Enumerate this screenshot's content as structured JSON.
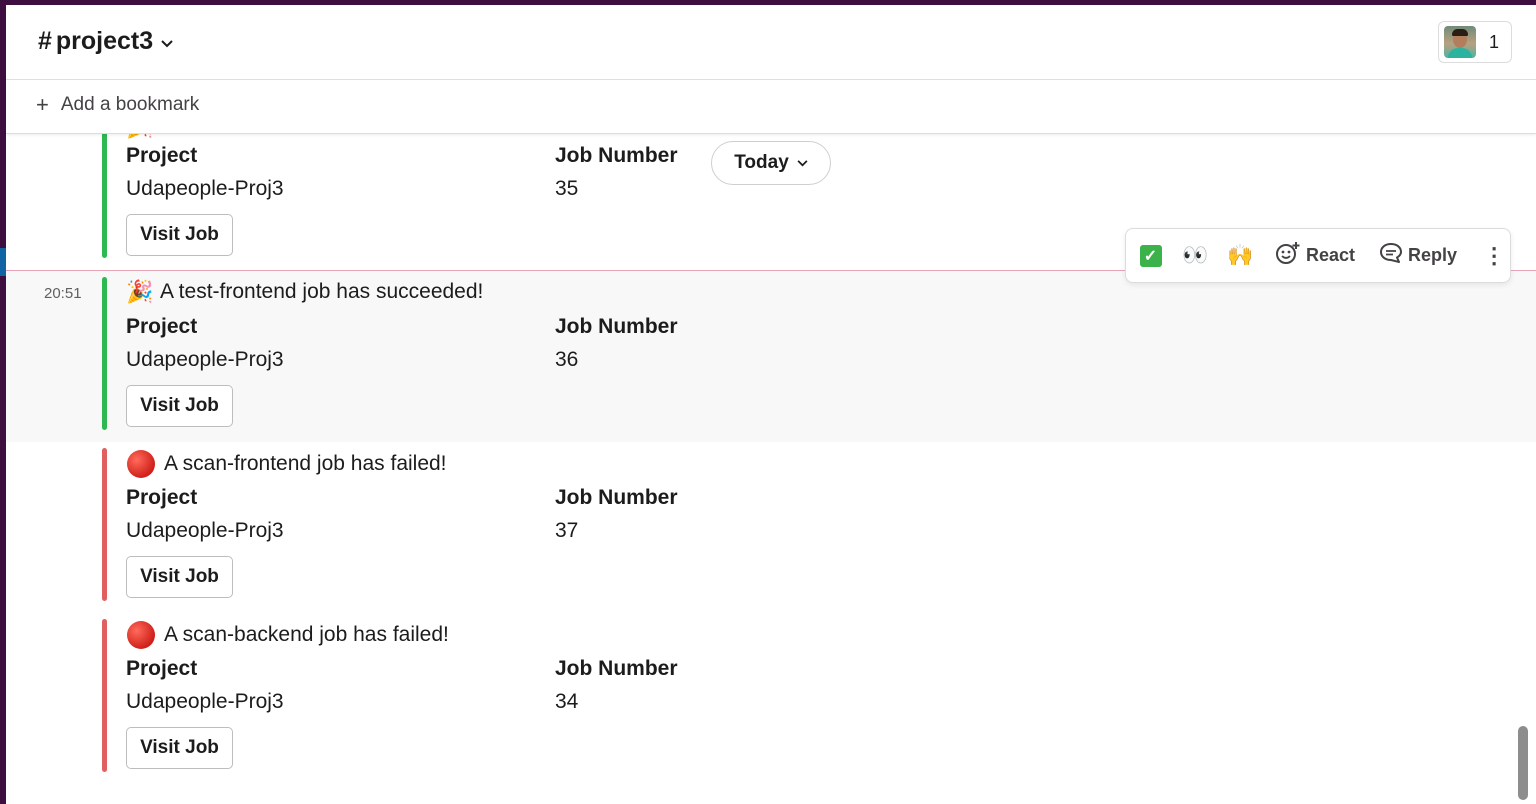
{
  "header": {
    "channel_hash": "#",
    "channel_name": "project3",
    "chevron": "⌄",
    "member_count": "1"
  },
  "bookmarks": {
    "plus": "+",
    "add_label": "Add a bookmark"
  },
  "date_divider": {
    "label": "Today"
  },
  "actions": {
    "react_label": "React",
    "reply_label": "Reply",
    "emoji_check": "white-check-mark",
    "emoji_eyes": "👀",
    "emoji_hands": "🙌",
    "more": "⋮"
  },
  "labels": {
    "project": "Project",
    "job_number": "Job Number",
    "visit_job": "Visit Job"
  },
  "messages": [
    {
      "time": "",
      "status": "success",
      "icon": "🎉",
      "text": "",
      "project": "Udapeople-Proj3",
      "job_number": "35"
    },
    {
      "time": "20:51",
      "status": "success",
      "icon": "🎉",
      "text": "A test-frontend job has succeeded!",
      "project": "Udapeople-Proj3",
      "job_number": "36"
    },
    {
      "time": "",
      "status": "failed",
      "icon": "red-circle",
      "text": "A scan-frontend job has failed!",
      "project": "Udapeople-Proj3",
      "job_number": "37"
    },
    {
      "time": "",
      "status": "failed",
      "icon": "red-circle",
      "text": "A scan-backend job has failed!",
      "project": "Udapeople-Proj3",
      "job_number": "34"
    }
  ],
  "colors": {
    "success_bar": "#2eb852",
    "failed_bar": "#e06060",
    "new_divider": "#e8a5b7",
    "sidebar": "#3f0e40"
  }
}
